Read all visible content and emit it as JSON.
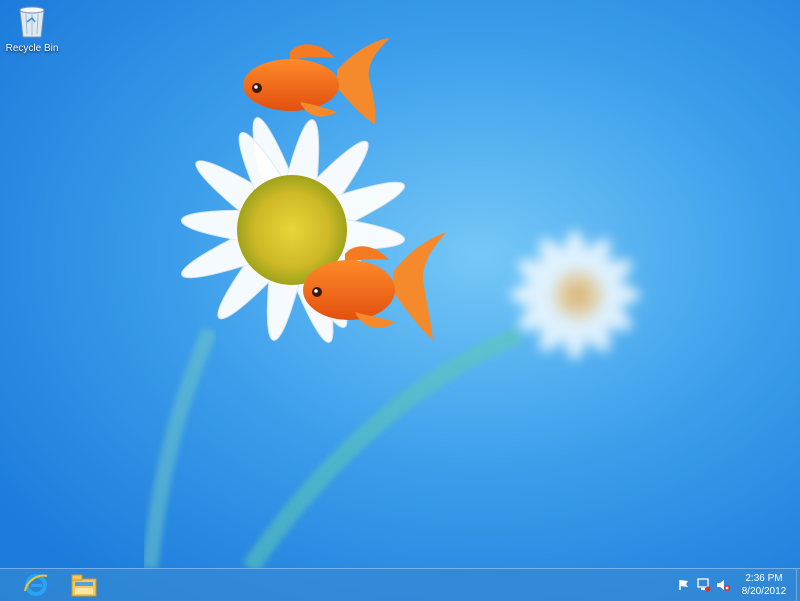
{
  "desktop": {
    "icons": [
      {
        "label": "Recycle Bin",
        "icon": "recycle-bin-icon"
      }
    ]
  },
  "taskbar": {
    "pinned": [
      {
        "icon": "internet-explorer-icon"
      },
      {
        "icon": "file-explorer-icon"
      }
    ],
    "tray": {
      "icons": [
        "action-center-flag-icon",
        "network-icon",
        "volume-muted-icon"
      ],
      "clock": {
        "time": "2:36 PM",
        "date": "8/20/2012"
      }
    }
  },
  "colors": {
    "background": "#2a8fe6",
    "taskbar": "#3686ce",
    "fish": "#f26a1b"
  }
}
